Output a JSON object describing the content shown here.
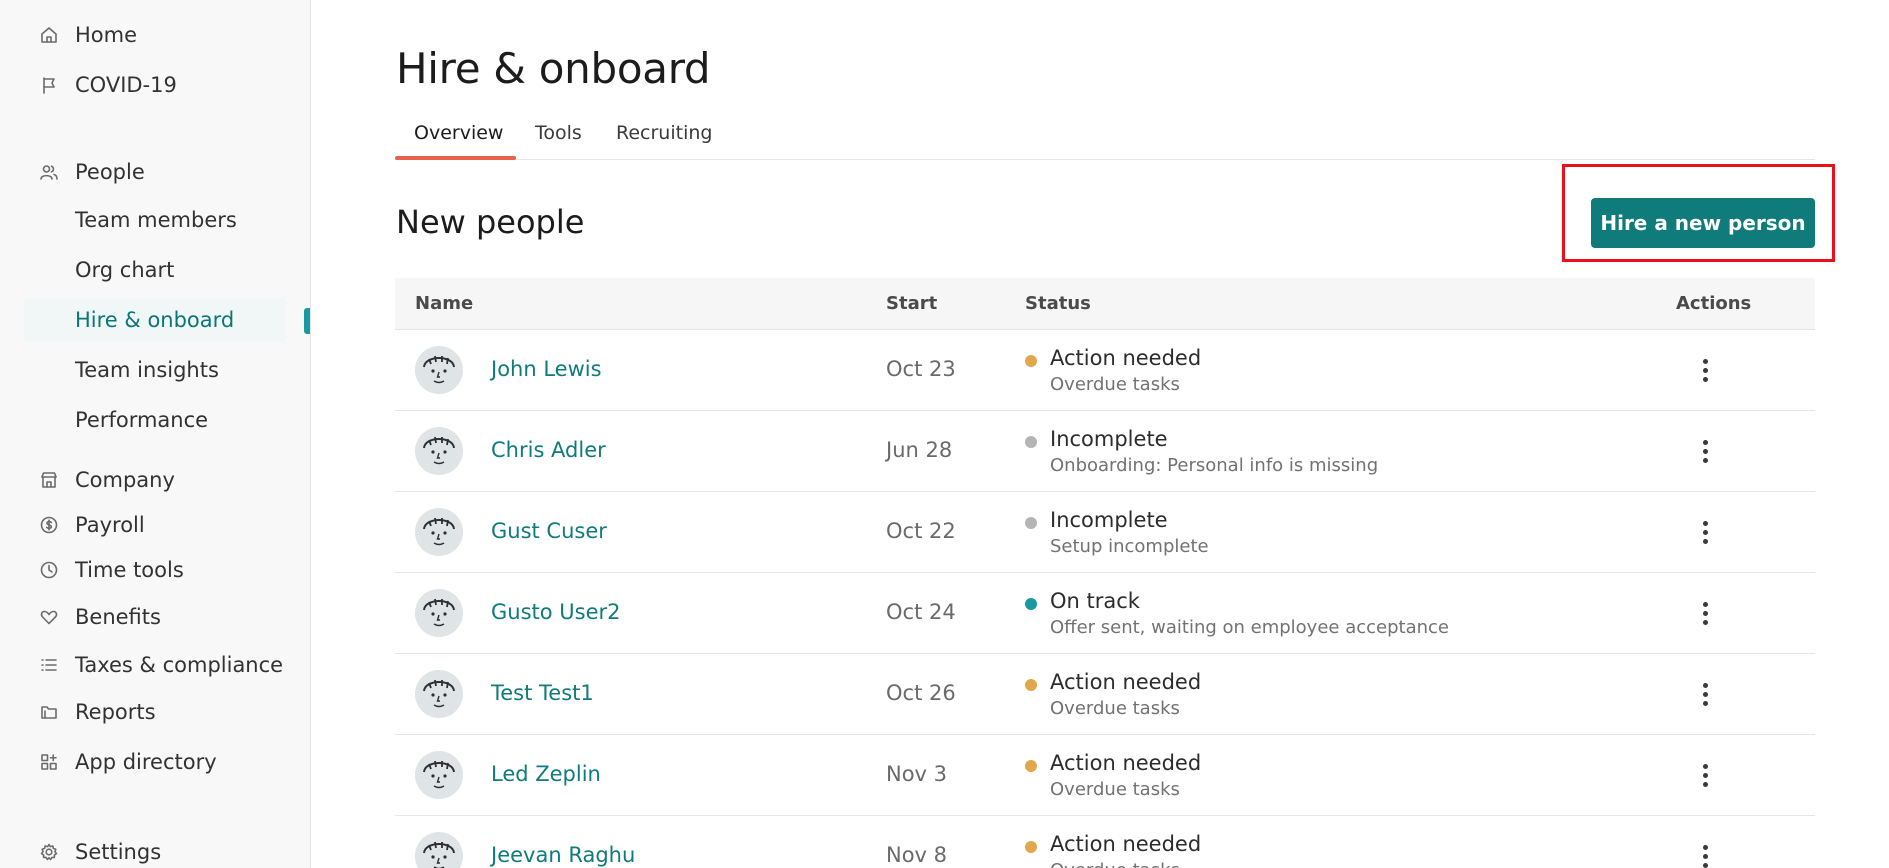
{
  "sidebar": {
    "items": [
      {
        "label": "Home",
        "icon": "home-icon"
      },
      {
        "label": "COVID-19",
        "icon": "flag-icon"
      },
      {
        "label": "People",
        "icon": "people-icon"
      },
      {
        "label": "Company",
        "icon": "store-icon"
      },
      {
        "label": "Payroll",
        "icon": "dollar-icon"
      },
      {
        "label": "Time tools",
        "icon": "clock-icon"
      },
      {
        "label": "Benefits",
        "icon": "heart-icon"
      },
      {
        "label": "Taxes & compliance",
        "icon": "list-icon"
      },
      {
        "label": "Reports",
        "icon": "folder-icon"
      },
      {
        "label": "App directory",
        "icon": "apps-icon"
      },
      {
        "label": "Settings",
        "icon": "gear-icon"
      }
    ],
    "people_sub": [
      "Team members",
      "Org chart",
      "Hire & onboard",
      "Team insights",
      "Performance"
    ],
    "active_sub": "Hire & onboard"
  },
  "page": {
    "title": "Hire & onboard",
    "tabs": [
      "Overview",
      "Tools",
      "Recruiting"
    ],
    "active_tab": "Overview",
    "section_title": "New people",
    "hire_button": "Hire a new person"
  },
  "table": {
    "headers": {
      "name": "Name",
      "start": "Start",
      "status": "Status",
      "actions": "Actions"
    },
    "rows": [
      {
        "name": "John Lewis",
        "start": "Oct 23",
        "status": "Action needed",
        "detail": "Overdue tasks",
        "status_color": "#e3a74b"
      },
      {
        "name": "Chris Adler",
        "start": "Jun 28",
        "status": "Incomplete",
        "detail": "Onboarding: Personal info is missing",
        "status_color": "#b4b4b4"
      },
      {
        "name": "Gust Cuser",
        "start": "Oct 22",
        "status": "Incomplete",
        "detail": "Setup incomplete",
        "status_color": "#b4b4b4"
      },
      {
        "name": "Gusto User2",
        "start": "Oct 24",
        "status": "On track",
        "detail": "Offer sent, waiting on employee acceptance",
        "status_color": "#1a9aa0"
      },
      {
        "name": "Test Test1",
        "start": "Oct 26",
        "status": "Action needed",
        "detail": "Overdue tasks",
        "status_color": "#e3a74b"
      },
      {
        "name": "Led Zeplin",
        "start": "Nov 3",
        "status": "Action needed",
        "detail": "Overdue tasks",
        "status_color": "#e3a74b"
      },
      {
        "name": "Jeevan Raghu",
        "start": "Nov 8",
        "status": "Action needed",
        "detail": "Overdue tasks",
        "status_color": "#e3a74b"
      }
    ]
  },
  "colors": {
    "brand": "#0f7b7a",
    "tab_accent": "#e9604d",
    "highlight": "#e8101a"
  }
}
